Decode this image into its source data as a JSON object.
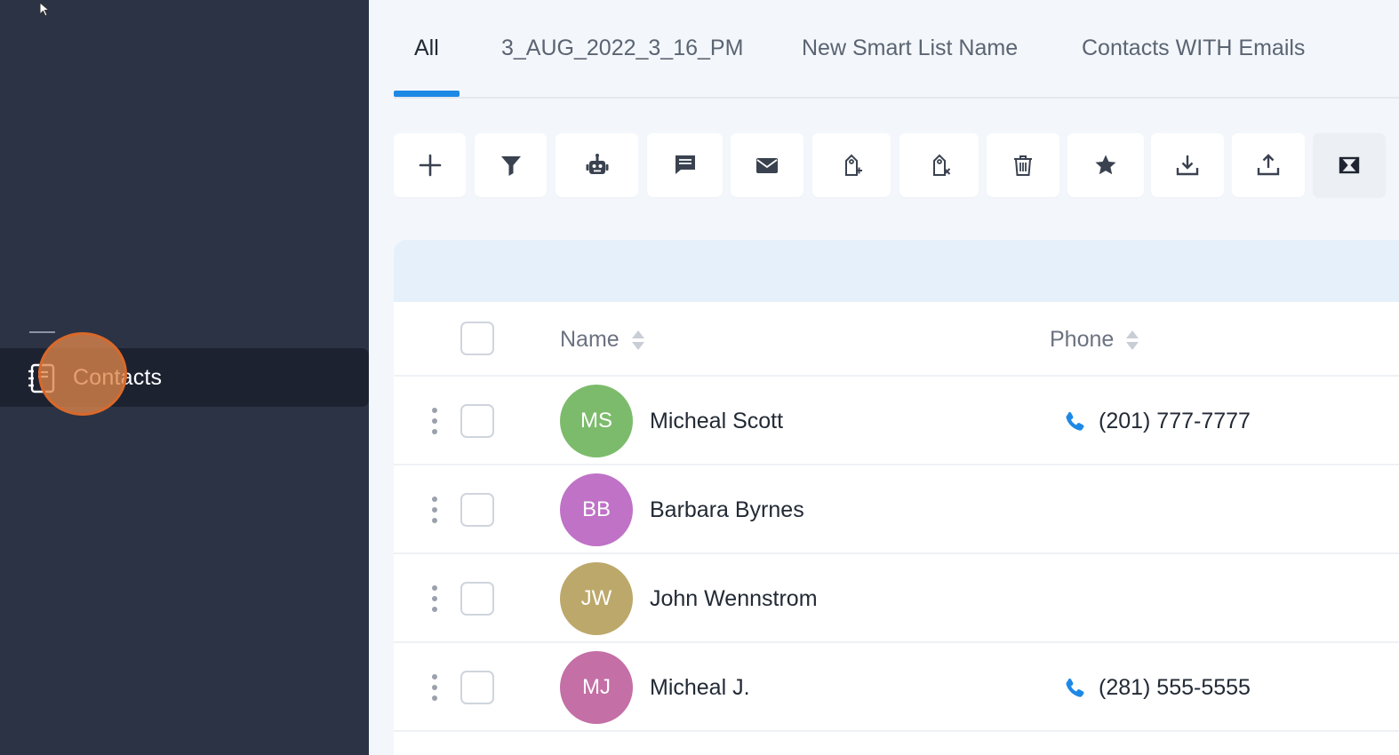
{
  "sidebar": {
    "active_item": {
      "label": "Contacts",
      "icon": "contacts-book-icon"
    }
  },
  "tabs": [
    {
      "label": "All",
      "active": true
    },
    {
      "label": "3_AUG_2022_3_16_PM",
      "active": false
    },
    {
      "label": "New Smart List Name",
      "active": false
    },
    {
      "label": "Contacts WITH Emails",
      "active": false
    }
  ],
  "toolbar": {
    "buttons": [
      "add-icon",
      "filter-icon",
      "robot-icon",
      "message-icon",
      "email-icon",
      "add-tag-icon",
      "remove-tag-icon",
      "trash-icon",
      "star-icon",
      "download-icon",
      "upload-icon",
      "merge-icon"
    ]
  },
  "table": {
    "columns": {
      "name": "Name",
      "phone": "Phone"
    },
    "rows": [
      {
        "initials": "MS",
        "name": "Micheal Scott",
        "phone": "(201) 777-7777",
        "avatar_color": "#7cbb6c"
      },
      {
        "initials": "BB",
        "name": "Barbara Byrnes",
        "phone": "",
        "avatar_color": "#bf72c6"
      },
      {
        "initials": "JW",
        "name": "John Wennstrom",
        "phone": "",
        "avatar_color": "#bca86a"
      },
      {
        "initials": "MJ",
        "name": "Micheal J.",
        "phone": "(281) 555-5555",
        "avatar_color": "#c46fa5"
      }
    ]
  },
  "colors": {
    "accent": "#1e88e5",
    "sidebar": "#2b3345",
    "sidebar_active": "#1d2230"
  }
}
